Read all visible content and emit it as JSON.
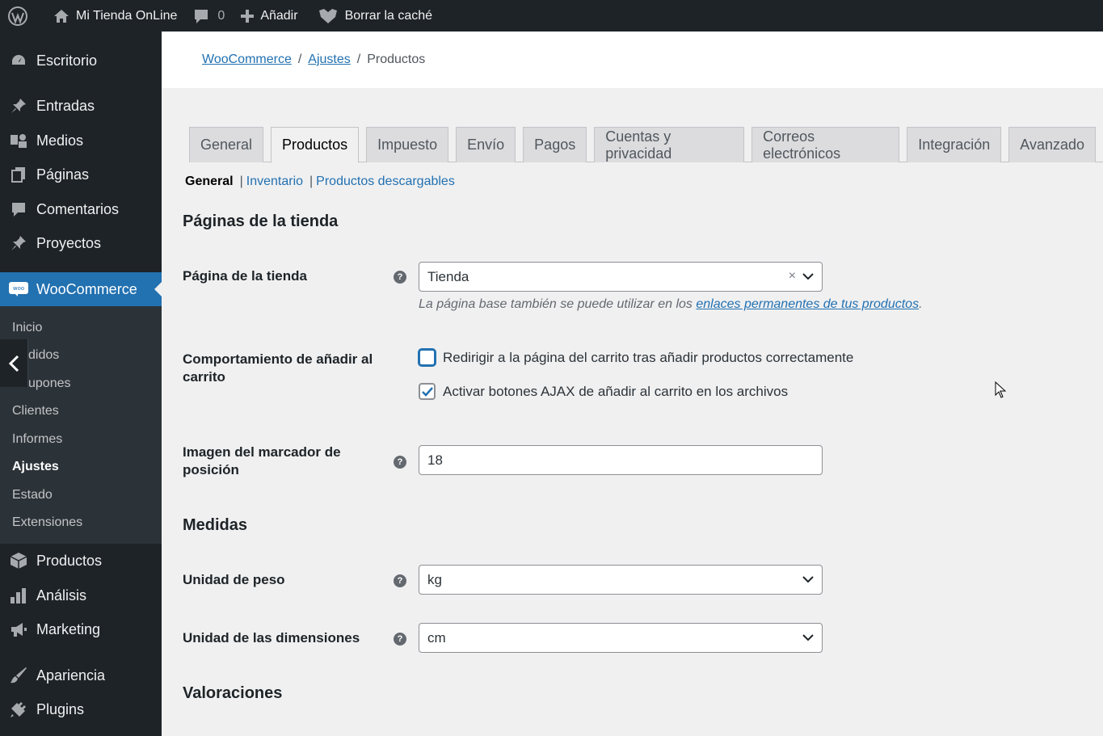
{
  "adminbar": {
    "site_name": "Mi Tienda OnLine",
    "comments_count": "0",
    "add_label": "Añadir",
    "cache_label": "Borrar la caché"
  },
  "sidebar": {
    "items": [
      {
        "label": "Escritorio",
        "icon": "dashboard-icon"
      },
      {
        "label": "Entradas",
        "icon": "pin-icon"
      },
      {
        "label": "Medios",
        "icon": "media-icon"
      },
      {
        "label": "Páginas",
        "icon": "pages-icon"
      },
      {
        "label": "Comentarios",
        "icon": "comments-icon"
      },
      {
        "label": "Proyectos",
        "icon": "pin-icon"
      },
      {
        "label": "WooCommerce",
        "icon": "woo-icon"
      },
      {
        "label": "Productos",
        "icon": "box-icon"
      },
      {
        "label": "Análisis",
        "icon": "chart-icon"
      },
      {
        "label": "Marketing",
        "icon": "megaphone-icon"
      },
      {
        "label": "Apariencia",
        "icon": "brush-icon"
      },
      {
        "label": "Plugins",
        "icon": "plug-icon"
      }
    ],
    "submenu": [
      "Inicio",
      "Pedidos",
      "Cupones",
      "Clientes",
      "Informes",
      "Ajustes",
      "Estado",
      "Extensiones"
    ],
    "submenu_visible": [
      "Inicio",
      "didos",
      "upones",
      "Clientes",
      "Informes",
      "Ajustes",
      "Estado",
      "Extensiones"
    ]
  },
  "breadcrumb": {
    "root": "WooCommerce",
    "parent": "Ajustes",
    "current": "Productos",
    "sep": "/"
  },
  "tabs": [
    "General",
    "Productos",
    "Impuesto",
    "Envío",
    "Pagos",
    "Cuentas y privacidad",
    "Correos electrónicos",
    "Integración",
    "Avanzado"
  ],
  "subnav": {
    "current": "General",
    "links": [
      "Inventario",
      "Productos descargables"
    ],
    "sep": "|"
  },
  "sections": {
    "shop_pages": "Páginas de la tienda",
    "measures": "Medidas",
    "reviews": "Valoraciones"
  },
  "fields": {
    "shop_page": {
      "label": "Página de la tienda",
      "value": "Tienda",
      "desc_prefix": "La página base también se puede utilizar en los ",
      "desc_link": "enlaces permanentes de tus productos",
      "desc_suffix": "."
    },
    "add_to_cart": {
      "label": "Comportamiento de añadir al carrito",
      "opt1": "Redirigir a la página del carrito tras añadir productos correctamente",
      "opt1_checked": false,
      "opt2": "Activar botones AJAX de añadir al carrito en los archivos",
      "opt2_checked": true
    },
    "placeholder_image": {
      "label": "Imagen del marcador de posición",
      "value": "18"
    },
    "weight_unit": {
      "label": "Unidad de peso",
      "value": "kg"
    },
    "dimension_unit": {
      "label": "Unidad de las dimensiones",
      "value": "cm"
    }
  },
  "help_glyph": "?",
  "clear_glyph": "×",
  "colors": {
    "accent": "#2271b1",
    "adminbar": "#1d2327",
    "submenu_bg": "#2c3338"
  }
}
